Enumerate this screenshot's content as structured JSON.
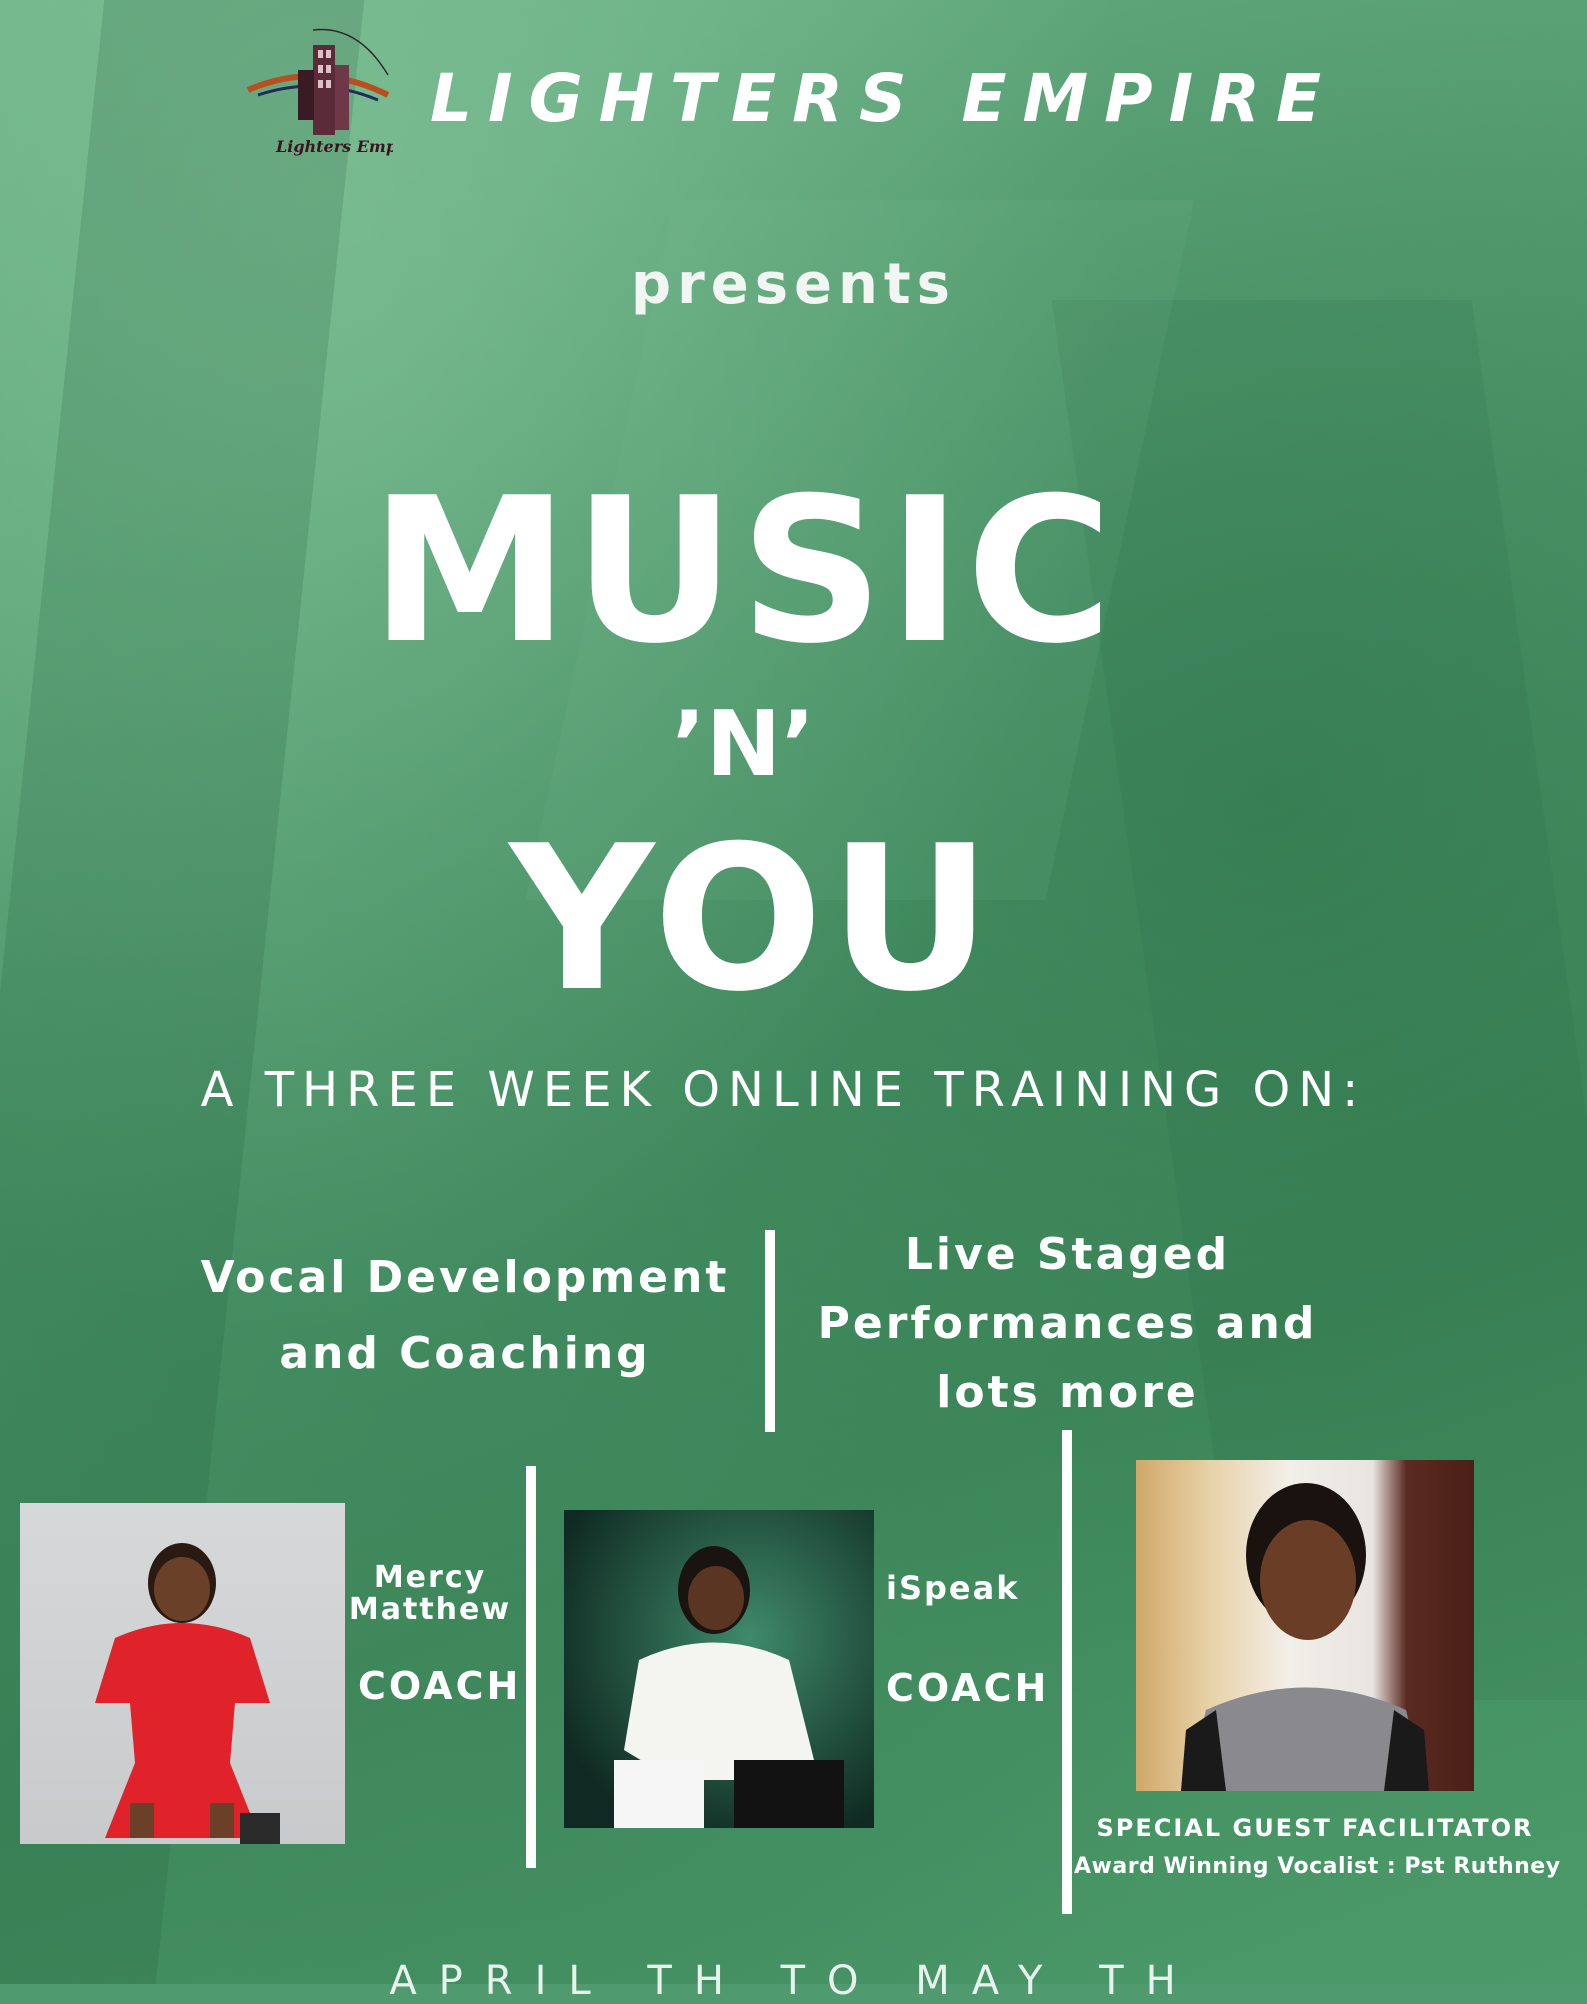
{
  "brand": {
    "name": "LIGHTERS EMPIRE",
    "logo_text": "Lighters Empire"
  },
  "presents": "presents",
  "event": {
    "title_line1": "MUSIC",
    "title_line2": "’N’",
    "title_line3": "YOU",
    "subtitle": "A THREE WEEK ONLINE TRAINING ON:"
  },
  "topics": {
    "left_line1": "Vocal Development",
    "left_line2": "and Coaching",
    "right_line1": "Live Staged",
    "right_line2": "Performances and",
    "right_line3": "lots more"
  },
  "coaches": [
    {
      "name_line1": "Mercy",
      "name_line2": "Matthew",
      "role": "COACH"
    },
    {
      "name_line1": "iSpeak",
      "role": "COACH"
    }
  ],
  "guest": {
    "title": "SPECIAL GUEST FACILITATOR",
    "description": "Award Winning Vocalist : Pst Ruthney"
  },
  "date_partial": "APRIL TH TO MAY TH",
  "colors": {
    "background": "#4f9a6f",
    "text": "#ffffff"
  }
}
